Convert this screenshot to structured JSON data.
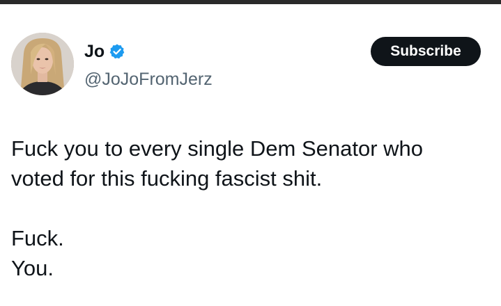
{
  "author": {
    "display_name": "Jo",
    "handle": "@JoJoFromJerz",
    "verified": true,
    "avatar": "profile-photo"
  },
  "actions": {
    "subscribe_label": "Subscribe"
  },
  "tweet": {
    "paragraphs": [
      [
        "Fuck you to every single Dem Senator who",
        "voted for this fucking fascist shit."
      ],
      [
        "Fuck.",
        "You."
      ]
    ]
  },
  "colors": {
    "verified_badge": "#1d9bf0",
    "button_bg": "#0f1419",
    "handle_text": "#536471",
    "top_bar": "#2a2a2a"
  }
}
